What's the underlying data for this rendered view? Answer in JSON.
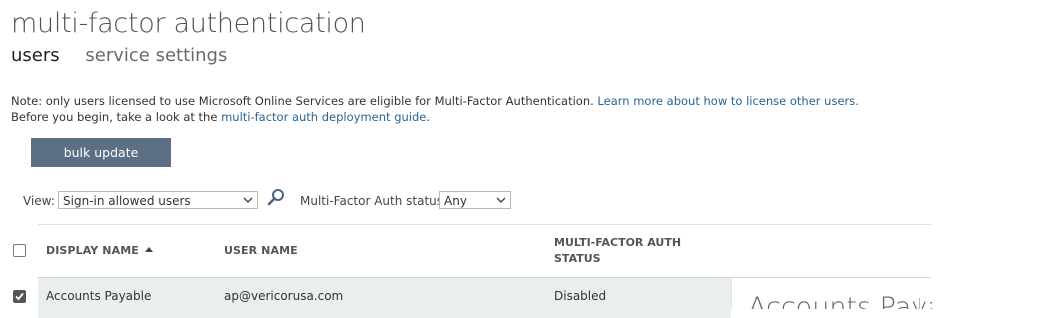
{
  "header": {
    "title": "multi-factor authentication",
    "tabs": [
      {
        "label": "users",
        "active": true
      },
      {
        "label": "service settings",
        "active": false
      }
    ]
  },
  "note": {
    "line1_text": "Note: only users licensed to use Microsoft Online Services are eligible for Multi-Factor Authentication.",
    "line1_link": "Learn more about how to license other users.",
    "line2_text": "Before you begin, take a look at the",
    "line2_link": "multi-factor auth deployment guide",
    "line2_end": "."
  },
  "bulk_update_label": "bulk update",
  "filters": {
    "view_label": "View:",
    "view_value": "Sign-in allowed users",
    "status_label": "Multi-Factor Auth status:",
    "status_value": "Any",
    "search_icon": "search-icon"
  },
  "table": {
    "columns": [
      {
        "label": "DISPLAY NAME",
        "sorted": "ascending"
      },
      {
        "label": "USER NAME"
      },
      {
        "label_line1": "MULTI-FACTOR AUTH",
        "label_line2": "STATUS"
      }
    ],
    "rows": [
      {
        "selected": true,
        "display_name": "Accounts Payable",
        "user_name": "ap@vericorusa.com",
        "mfa_status": "Disabled"
      }
    ]
  },
  "detail_panel": {
    "title": "Accounts Payabl"
  },
  "colors": {
    "button_bg": "#5d6f85",
    "link": "#2a6496",
    "selected_row_bg": "#eaeeee"
  }
}
